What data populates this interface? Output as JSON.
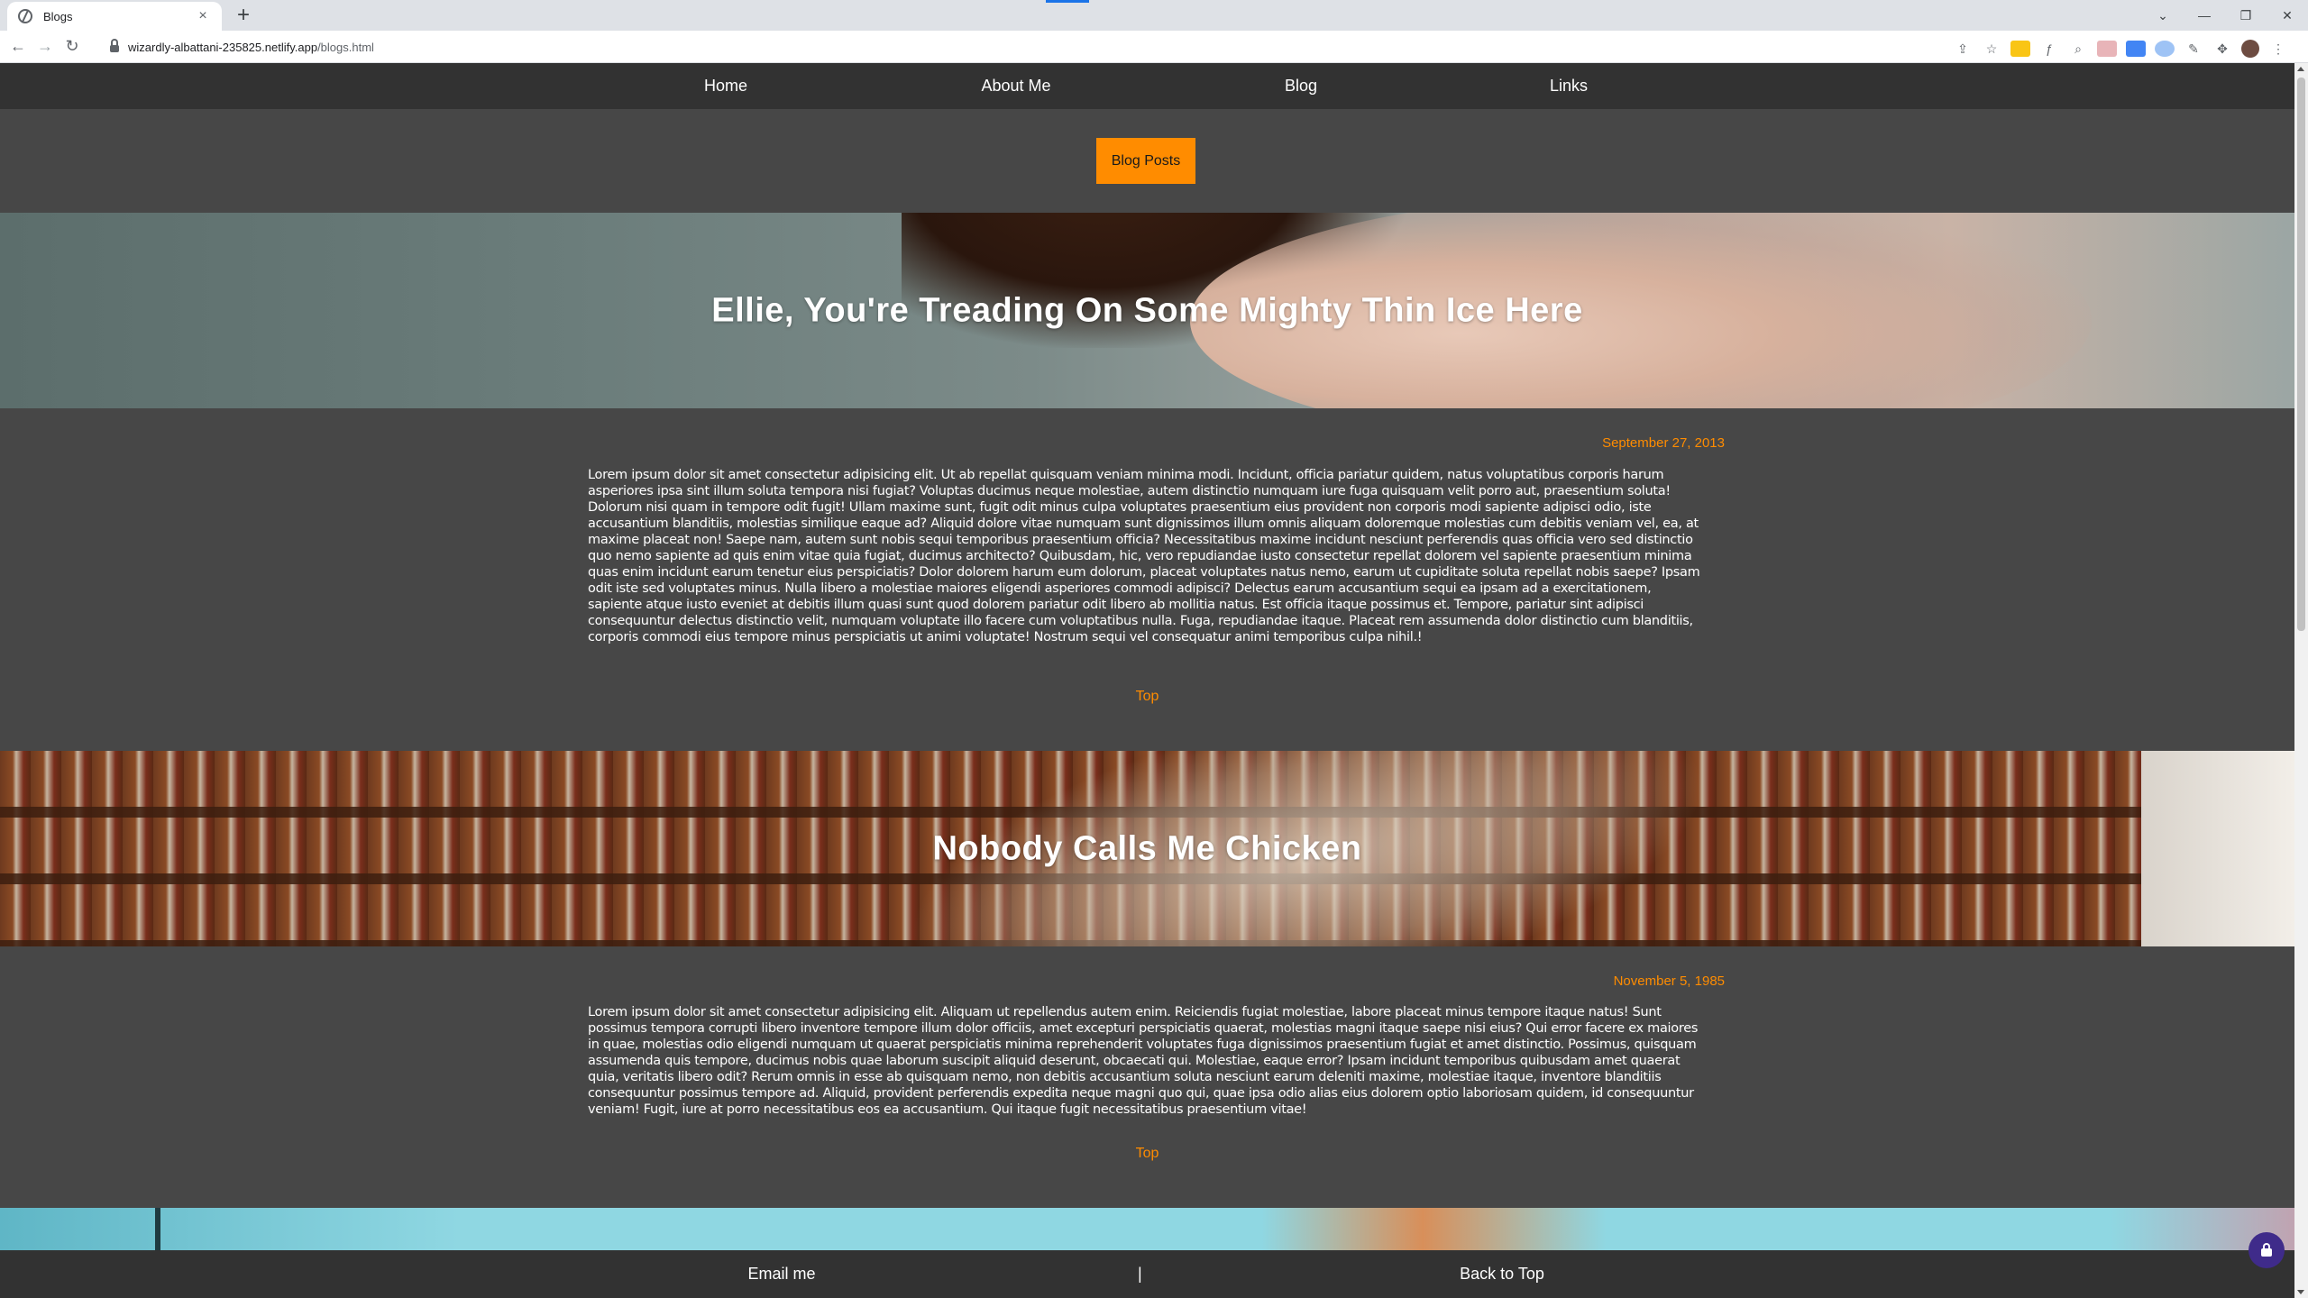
{
  "browser": {
    "tab_title": "Blogs",
    "tab_close": "×",
    "new_tab": "+",
    "url_host": "wizardly-albattani-235825.netlify.app",
    "url_path": "/blogs.html",
    "window_controls": [
      "⌄",
      "—",
      "❐",
      "✕"
    ]
  },
  "nav": {
    "items": [
      "Home",
      "About Me",
      "Blog",
      "Links"
    ]
  },
  "header_button": "Blog Posts",
  "posts": [
    {
      "title": "Ellie, You're Treading On Some Mighty Thin Ice Here",
      "date": "September 27, 2013",
      "body": "Lorem ipsum dolor sit amet consectetur adipisicing elit. Ut ab repellat quisquam veniam minima modi. Incidunt, officia pariatur quidem, natus voluptatibus corporis harum asperiores ipsa sint illum soluta tempora nisi fugiat? Voluptas ducimus neque molestiae, autem distinctio numquam iure fuga quisquam velit porro aut, praesentium soluta! Dolorum nisi quam in tempore odit fugit! Ullam maxime sunt, fugit odit minus culpa voluptates praesentium eius provident non corporis modi sapiente adipisci odio, iste accusantium blanditiis, molestias similique eaque ad? Aliquid dolore vitae numquam sunt dignissimos illum omnis aliquam doloremque molestias cum debitis veniam vel, ea, at maxime placeat non! Saepe nam, autem sunt nobis sequi temporibus praesentium officia? Necessitatibus maxime incidunt nesciunt perferendis quas officia vero sed distinctio quo nemo sapiente ad quis enim vitae quia fugiat, ducimus architecto? Quibusdam, hic, vero repudiandae iusto consectetur repellat dolorem vel sapiente praesentium minima quas enim incidunt earum tenetur eius perspiciatis? Dolor dolorem harum eum dolorum, placeat voluptates natus nemo, earum ut cupiditate soluta repellat nobis saepe? Ipsam odit iste sed voluptates minus. Nulla libero a molestiae maiores eligendi asperiores commodi adipisci? Delectus earum accusantium sequi ea ipsam ad a exercitationem, sapiente atque iusto eveniet at debitis illum quasi sunt quod dolorem pariatur odit libero ab mollitia natus. Est officia itaque possimus et. Tempore, pariatur sint adipisci consequuntur delectus distinctio velit, numquam voluptate illo facere cum voluptatibus nulla. Fuga, repudiandae itaque. Placeat rem assumenda dolor distinctio cum blanditiis, corporis commodi eius tempore minus perspiciatis ut animi voluptate! Nostrum sequi vel consequatur animi temporibus culpa nihil.!",
      "top_link": "Top"
    },
    {
      "title": "Nobody Calls Me Chicken",
      "date": "November 5, 1985",
      "body": "Lorem ipsum dolor sit amet consectetur adipisicing elit. Aliquam ut repellendus autem enim. Reiciendis fugiat molestiae, labore placeat minus tempore itaque natus! Sunt possimus tempora corrupti libero inventore tempore illum dolor officiis, amet excepturi perspiciatis quaerat, molestias magni itaque saepe nisi eius? Qui error facere ex maiores in quae, molestias odio eligendi numquam ut quaerat perspiciatis minima reprehenderit voluptates fuga dignissimos praesentium fugiat et amet distinctio. Possimus, quisquam assumenda quis tempore, ducimus nobis quae laborum suscipit aliquid deserunt, obcaecati qui. Molestiae, eaque error? Ipsam incidunt temporibus quibusdam amet quaerat quia, veritatis libero odit? Rerum omnis in esse ab quisquam nemo, non debitis accusantium soluta nesciunt earum deleniti maxime, molestiae itaque, inventore blanditiis consequuntur possimus tempore ad. Aliquid, provident perferendis expedita neque magni quo qui, quae ipsa odio alias eius dolorem optio laboriosam quidem, id consequuntur veniam! Fugit, iure at porro necessitatibus eos ea accusantium. Qui itaque fugit necessitatibus praesentium vitae!",
      "top_link": "Top"
    }
  ],
  "footer": {
    "email": "Email me",
    "separator": "|",
    "back_to_top": "Back to Top"
  },
  "colors": {
    "accent": "#ff8c00",
    "page_bg": "#474747",
    "nav_bg": "#323232"
  }
}
